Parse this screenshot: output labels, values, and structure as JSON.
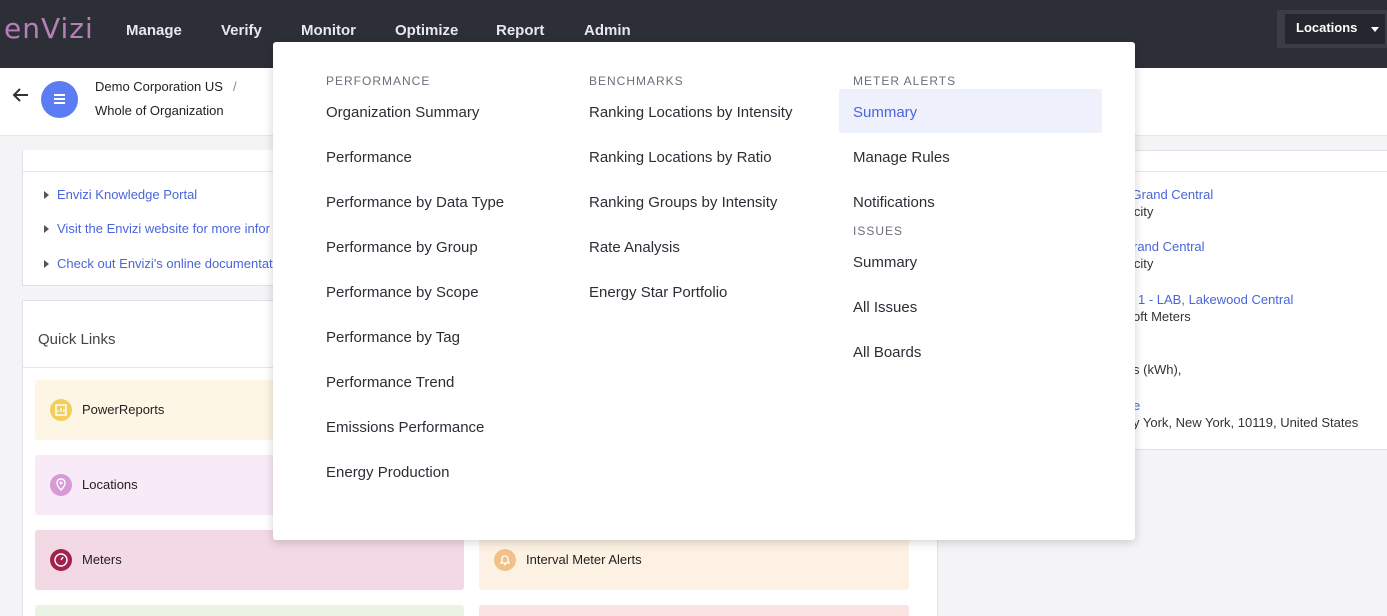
{
  "nav": {
    "logo": "enVizi",
    "items": [
      "Manage",
      "Verify",
      "Monitor",
      "Optimize",
      "Report",
      "Admin"
    ],
    "locations_label": "Locations"
  },
  "breadcrumb": {
    "level1": "Demo Corporation US",
    "separator": "/",
    "level2": "Whole of Organization"
  },
  "help_links": [
    "Envizi Knowledge Portal",
    "Visit the Envizi website for more infor",
    "Check out Envizi's online documentat"
  ],
  "quick_links": {
    "title": "Quick Links",
    "tiles": [
      {
        "label": "PowerReports",
        "bg": "#fdf6e4",
        "icon": "report-icon",
        "icon_color": "#f2cf5b"
      },
      {
        "label": "Locations",
        "bg": "#f8eaf6",
        "icon": "location-pin-icon",
        "icon_color": "#d79ad6"
      },
      {
        "label": "Meters",
        "bg": "#f2d9e4",
        "icon": "gauge-icon",
        "icon_color": "#a0234e"
      },
      {
        "label": "Interval Meter Alerts",
        "bg": "#fdf1e3",
        "icon": "bell-icon",
        "icon_color": "#f0c28a"
      }
    ]
  },
  "right_panel": {
    "rows": [
      {
        "link": "), Grand Central",
        "sub": "icity"
      },
      {
        "link": "rand Central",
        "sub": "icity"
      },
      {
        "link": "1 - LAB, Lakewood Central",
        "sub": "oft Meters"
      },
      {
        "link": "",
        "sub": "s (kWh),"
      },
      {
        "link": "e",
        "sub": "y York, New York, 10119, United States"
      }
    ]
  },
  "dropdown": {
    "columns": [
      {
        "heading": "PERFORMANCE",
        "items": [
          "Organization Summary",
          "Performance",
          "Performance by Data Type",
          "Performance by Group",
          "Performance by Scope",
          "Performance by Tag",
          "Performance Trend",
          "Emissions Performance",
          "Energy Production"
        ]
      },
      {
        "heading": "BENCHMARKS",
        "items": [
          "Ranking Locations by Intensity",
          "Ranking Locations by Ratio",
          "Ranking Groups by Intensity",
          "Rate Analysis",
          "Energy Star Portfolio"
        ]
      },
      {
        "heading": "METER ALERTS",
        "items": [
          "Summary",
          "Manage Rules",
          "Notifications"
        ],
        "active": "Summary",
        "heading2": "ISSUES",
        "items2": [
          "Summary",
          "All Issues",
          "All Boards"
        ]
      }
    ]
  },
  "colors": {
    "nav_bg": "#2d2f37",
    "accent": "#4a66d8",
    "active_bg": "#eef1fc"
  }
}
